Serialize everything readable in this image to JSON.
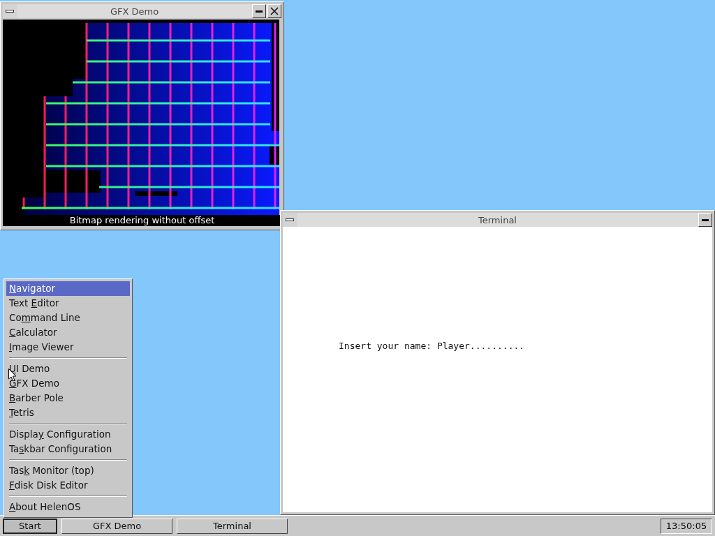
{
  "windows": [
    {
      "title": "GFX Demo",
      "caption": "Bitmap rendering without offset",
      "closable": true
    },
    {
      "title": "Terminal",
      "text": "Insert your name: Player..........",
      "closable": false
    }
  ],
  "start_menu": {
    "items": [
      {
        "kind": "item",
        "key": "N",
        "after": "avigator",
        "selected": true
      },
      {
        "kind": "item",
        "before": "Text ",
        "key": "E",
        "after": "ditor",
        "selected": false
      },
      {
        "kind": "item",
        "before": "Co",
        "key": "m",
        "after": "mand Line",
        "selected": false
      },
      {
        "kind": "item",
        "key": "C",
        "after": "alculator",
        "selected": false
      },
      {
        "kind": "item",
        "key": "I",
        "after": "mage Viewer",
        "selected": false
      },
      {
        "kind": "separator"
      },
      {
        "kind": "item",
        "key": "U",
        "after": "I Demo",
        "selected": false
      },
      {
        "kind": "item",
        "key": "G",
        "after": "FX Demo",
        "selected": false
      },
      {
        "kind": "item",
        "key": "B",
        "after": "arber Pole",
        "selected": false
      },
      {
        "kind": "item",
        "key": "T",
        "after": "etris",
        "selected": false
      },
      {
        "kind": "separator"
      },
      {
        "kind": "item",
        "before": "Displa",
        "key": "y",
        "after": " Configuration",
        "selected": false
      },
      {
        "kind": "item",
        "before": "Ta",
        "key": "s",
        "after": "kbar Configuration",
        "selected": false
      },
      {
        "kind": "separator"
      },
      {
        "kind": "item",
        "before": "Tas",
        "key": "k",
        "after": " Monitor (top)",
        "selected": false
      },
      {
        "kind": "item",
        "key": "F",
        "after": "disk Disk Editor",
        "selected": false
      },
      {
        "kind": "separator"
      },
      {
        "kind": "item",
        "key": "A",
        "after": "bout HelenOS",
        "selected": false
      }
    ]
  },
  "taskbar": {
    "start": {
      "label": "Start",
      "pressed": true
    },
    "tasks": [
      {
        "label": "GFX Demo",
        "pressed": false
      },
      {
        "label": "Terminal",
        "pressed": false
      }
    ],
    "clock": "13:50:05"
  }
}
